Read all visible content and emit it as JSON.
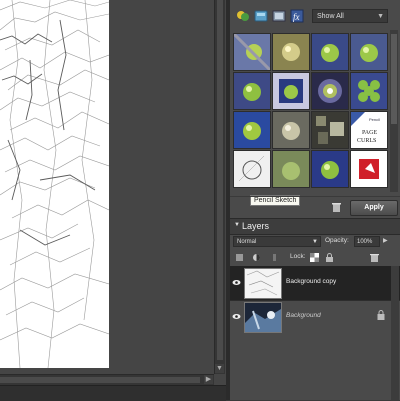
{
  "effects_panel": {
    "filter_select": "Show All",
    "icons": [
      "filters-icon",
      "layer-styles-icon",
      "photo-effects-icon",
      "fx-icon"
    ],
    "thumbnails": [
      {
        "name": "filter-thumb-1"
      },
      {
        "name": "filter-thumb-2"
      },
      {
        "name": "filter-thumb-3"
      },
      {
        "name": "filter-thumb-4"
      },
      {
        "name": "filter-thumb-5"
      },
      {
        "name": "filter-thumb-6"
      },
      {
        "name": "filter-thumb-7"
      },
      {
        "name": "filter-thumb-8"
      },
      {
        "name": "filter-thumb-9"
      },
      {
        "name": "filter-thumb-10"
      },
      {
        "name": "filter-thumb-11"
      },
      {
        "name": "filter-thumb-page-curls",
        "label_line1": "Pencil",
        "label_line2": "PAGE",
        "label_line3": "CURLS"
      },
      {
        "name": "filter-thumb-pencil-sketch"
      },
      {
        "name": "filter-thumb-14"
      },
      {
        "name": "filter-thumb-15"
      },
      {
        "name": "filter-thumb-16"
      }
    ],
    "tooltip": "Pencil Sketch",
    "apply_label": "Apply"
  },
  "layers_panel": {
    "title": "Layers",
    "blend_mode": "Normal",
    "opacity_label": "Opacity:",
    "opacity_value": "100%",
    "lock_label": "Lock:",
    "layers": [
      {
        "name": "Background copy",
        "selected": true,
        "locked": false
      },
      {
        "name": "Background",
        "selected": false,
        "locked": true
      }
    ]
  },
  "colors": {
    "panel_bg": "#4a4a4a",
    "selected_row": "#232323",
    "canvas_bg": "#454545"
  }
}
